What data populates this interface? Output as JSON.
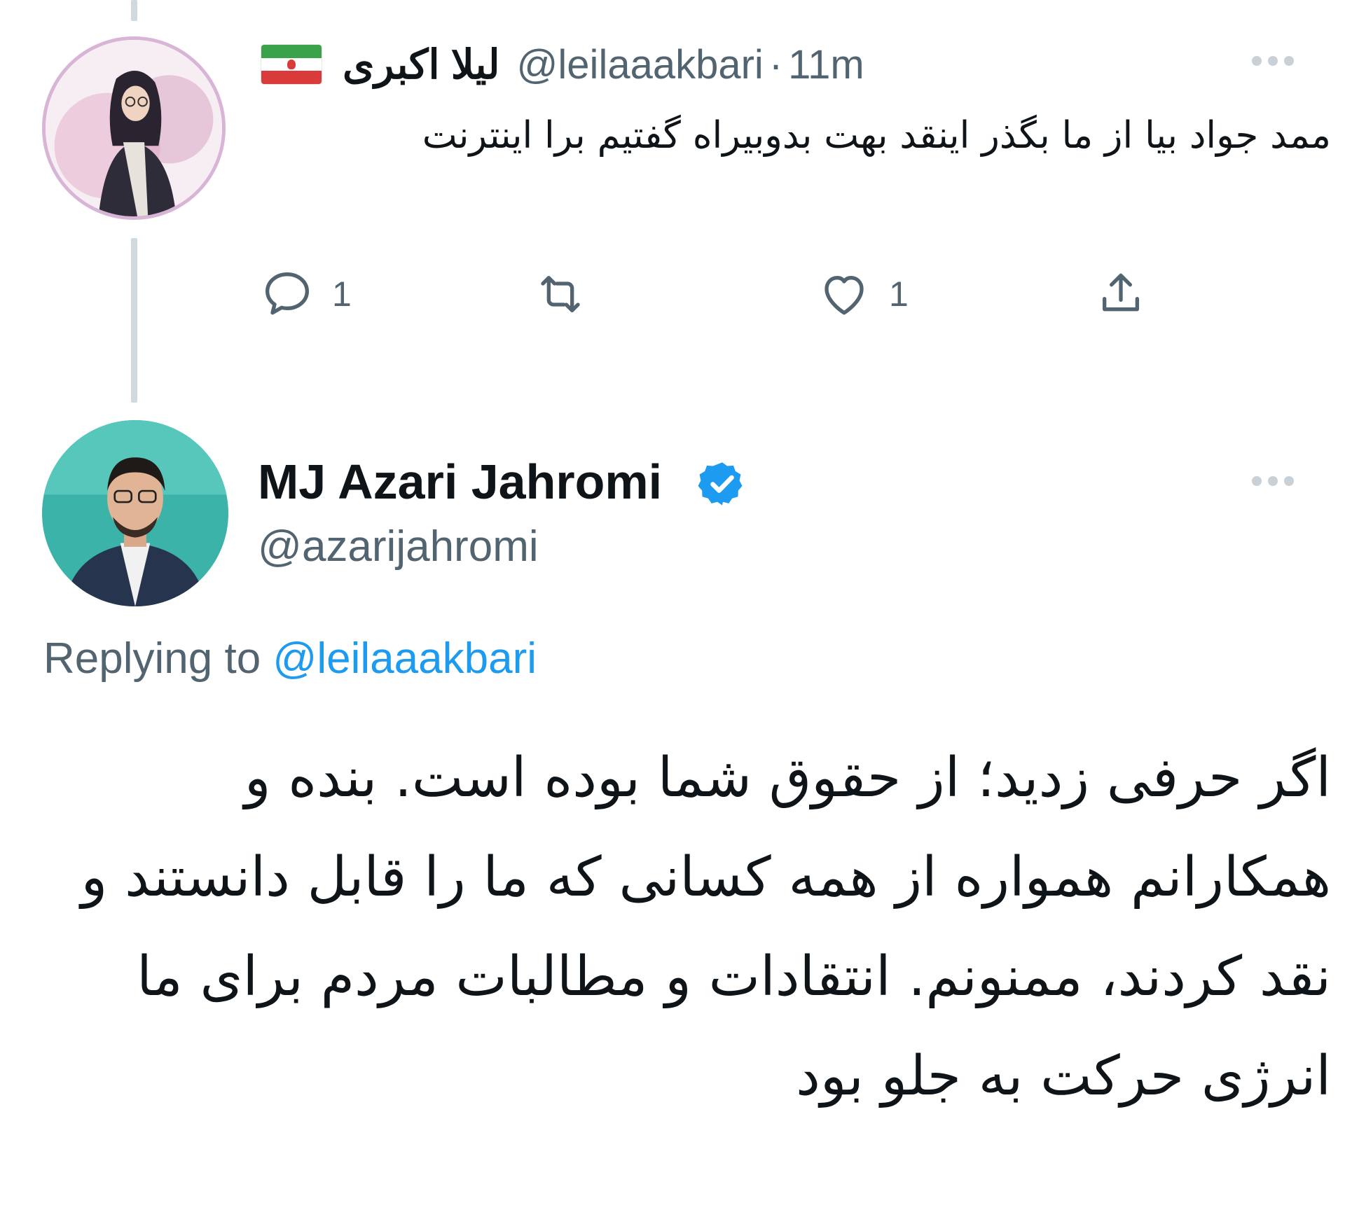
{
  "thread": {
    "tweet_parent": {
      "display_name": "لیلا اکبری",
      "handle": "@leilaaakbari",
      "separator": "·",
      "time": "11m",
      "text": "ممد جواد بیا از ما بگذر اینقد بهت بدوبیراه گفتیم برا اینترنت",
      "flag_icon": "iran-flag-icon",
      "actions": {
        "reply_count": "1",
        "retweet_count": "",
        "like_count": "1"
      }
    },
    "tweet_reply": {
      "display_name": "MJ Azari Jahromi",
      "handle": "@azarijahromi",
      "replying_prefix": "Replying to",
      "replying_to": "@leilaaakbari",
      "verified": true,
      "text": "اگر حرفی زدید؛ از حقوق شما بوده است. بنده و همکارانم همواره از همه کسانی که ما را قابل دانستند و  نقد کردند، ممنونم. انتقادات و مطالبات مردم برای ما انرژی حرکت به جلو بود"
    }
  },
  "colors": {
    "text_primary": "#0f1419",
    "text_secondary": "#536471",
    "accent": "#1d9bf0",
    "thread_line": "#cfd9de"
  }
}
